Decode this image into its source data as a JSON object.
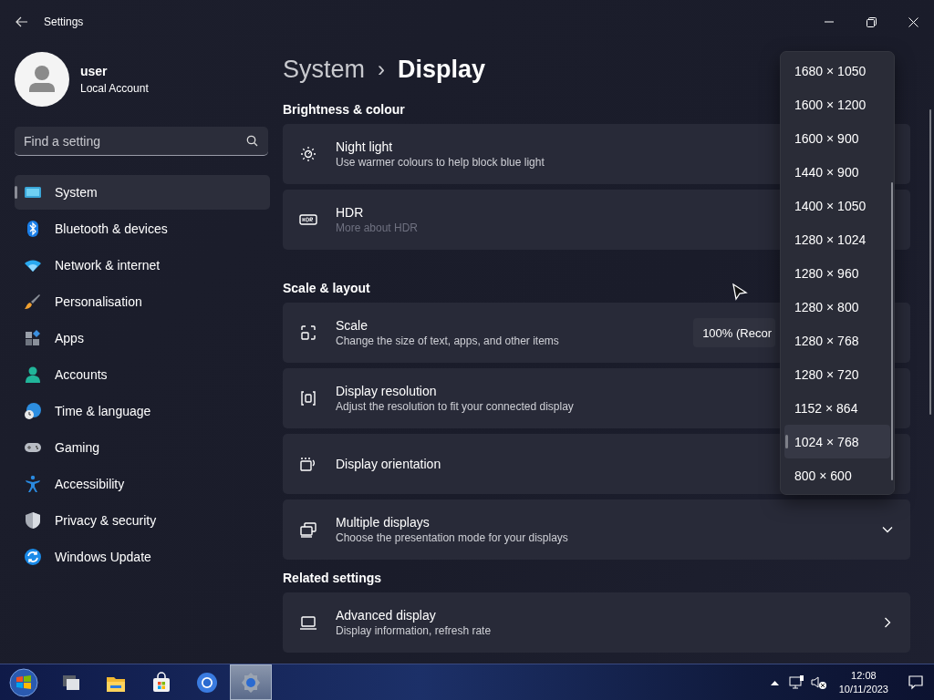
{
  "window": {
    "title": "Settings"
  },
  "user": {
    "name": "user",
    "account_type": "Local Account"
  },
  "search": {
    "placeholder": "Find a setting"
  },
  "nav": [
    {
      "label": "System",
      "selected": true
    },
    {
      "label": "Bluetooth & devices",
      "selected": false
    },
    {
      "label": "Network & internet",
      "selected": false
    },
    {
      "label": "Personalisation",
      "selected": false
    },
    {
      "label": "Apps",
      "selected": false
    },
    {
      "label": "Accounts",
      "selected": false
    },
    {
      "label": "Time & language",
      "selected": false
    },
    {
      "label": "Gaming",
      "selected": false
    },
    {
      "label": "Accessibility",
      "selected": false
    },
    {
      "label": "Privacy & security",
      "selected": false
    },
    {
      "label": "Windows Update",
      "selected": false
    }
  ],
  "breadcrumb": {
    "parent": "System",
    "separator": "›",
    "current": "Display"
  },
  "sections": [
    {
      "heading": "Brightness & colour",
      "items": [
        {
          "kind": "plain",
          "title": "Night light",
          "subtitle": "Use warmer colours to help block blue light",
          "subtitle_dimmed": false
        },
        {
          "kind": "plain",
          "title": "HDR",
          "subtitle": "More about HDR",
          "subtitle_dimmed": true
        }
      ]
    },
    {
      "heading": "Scale & layout",
      "items": [
        {
          "kind": "dropdown",
          "title": "Scale",
          "subtitle": "Change the size of text, apps, and other items",
          "subtitle_dimmed": false,
          "value": "100% (Recor"
        },
        {
          "kind": "plain",
          "title": "Display resolution",
          "subtitle": "Adjust the resolution to fit your connected display",
          "subtitle_dimmed": false
        },
        {
          "kind": "plain",
          "title": "Display orientation"
        },
        {
          "kind": "expander",
          "title": "Multiple displays",
          "subtitle": "Choose the presentation mode for your displays",
          "subtitle_dimmed": false
        }
      ]
    },
    {
      "heading": "Related settings",
      "items": [
        {
          "kind": "link",
          "title": "Advanced display",
          "subtitle": "Display information, refresh rate",
          "subtitle_dimmed": false
        }
      ]
    }
  ],
  "resolution_menu": [
    {
      "label": "1680 × 1050",
      "selected": false
    },
    {
      "label": "1600 × 1200",
      "selected": false
    },
    {
      "label": "1600 × 900",
      "selected": false
    },
    {
      "label": "1440 × 900",
      "selected": false
    },
    {
      "label": "1400 × 1050",
      "selected": false
    },
    {
      "label": "1280 × 1024",
      "selected": false
    },
    {
      "label": "1280 × 960",
      "selected": false
    },
    {
      "label": "1280 × 800",
      "selected": false
    },
    {
      "label": "1280 × 768",
      "selected": false
    },
    {
      "label": "1280 × 720",
      "selected": false
    },
    {
      "label": "1152 × 864",
      "selected": false
    },
    {
      "label": "1024 × 768",
      "selected": true
    },
    {
      "label": "800 × 600",
      "selected": false
    }
  ],
  "taskbar": {
    "apps": [
      {
        "active": false
      },
      {
        "active": false
      },
      {
        "active": false
      },
      {
        "active": false
      },
      {
        "active": true
      }
    ],
    "time": "12:08",
    "date": "10/11/2023"
  }
}
